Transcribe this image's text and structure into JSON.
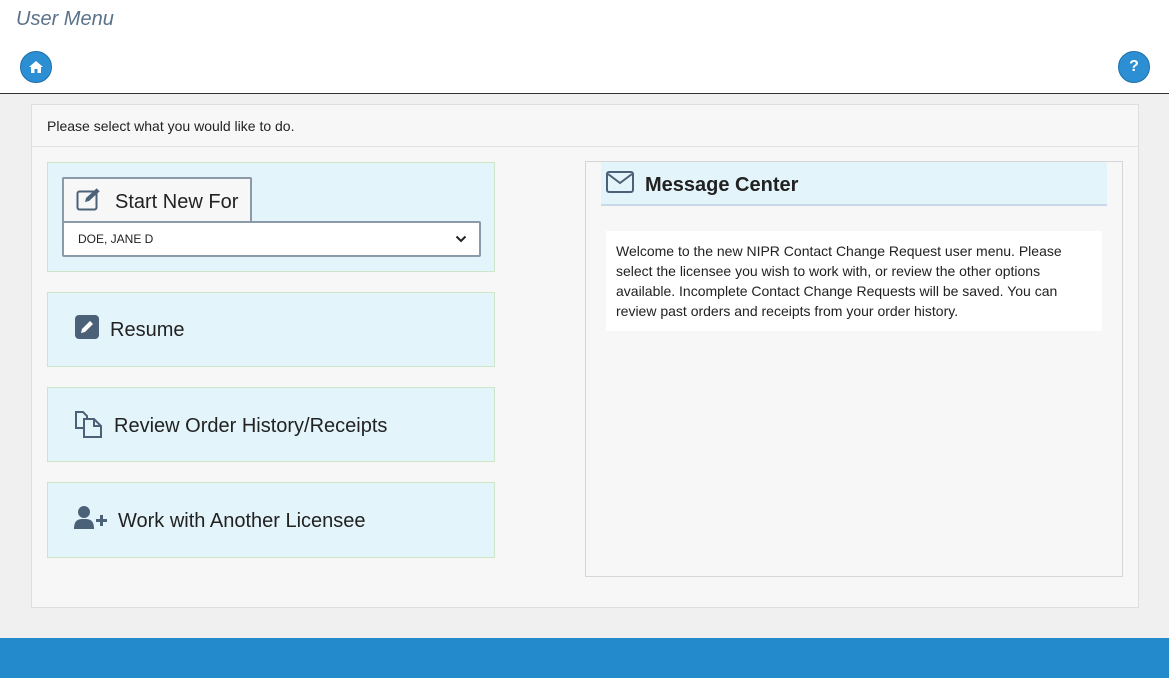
{
  "header": {
    "title": "User Menu",
    "home_icon": "home-icon",
    "help_label": "?"
  },
  "main": {
    "instruction": "Please select what you would like to do.",
    "start_new": {
      "label": "Start New For",
      "icon": "edit-square-icon",
      "selected_licensee": "DOE, JANE D"
    },
    "resume": {
      "label": "Resume",
      "icon": "pencil-square-icon"
    },
    "history": {
      "label": "Review Order History/Receipts",
      "icon": "copy-documents-icon"
    },
    "another": {
      "label": "Work with Another Licensee",
      "icon": "user-add-icon"
    }
  },
  "message_center": {
    "title": "Message Center",
    "icon": "envelope-icon",
    "body": "Welcome to the new NIPR Contact Change Request user menu. Please select the licensee you wish to work with, or review the other options available. Incomplete Contact Change Requests will be saved. You can review past orders and receipts from your order history."
  },
  "colors": {
    "accent": "#238bcc",
    "card_bg": "#e3f4fb",
    "title": "#5a7289"
  }
}
